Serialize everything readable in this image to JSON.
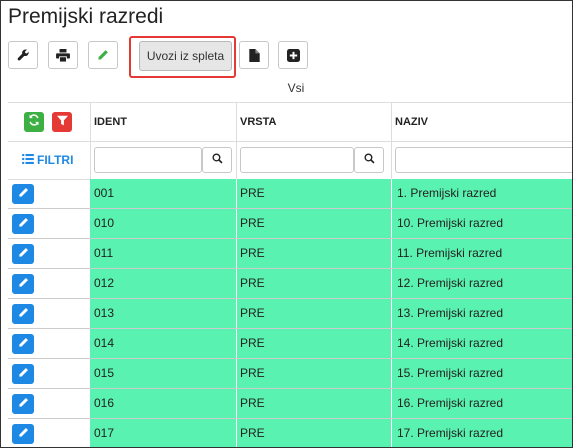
{
  "page": {
    "title": "Premijski razredi"
  },
  "toolbar": {
    "buttons": [
      {
        "name": "settings",
        "icon": "wrench-icon"
      },
      {
        "name": "print",
        "icon": "printer-icon"
      },
      {
        "name": "edit",
        "icon": "pencil-icon"
      },
      {
        "name": "new-document",
        "icon": "file-icon"
      },
      {
        "name": "add",
        "icon": "plus-square-icon"
      }
    ],
    "import_label": "Uvozi iz spleta"
  },
  "filter_label": "Vsi",
  "grid": {
    "columns": [
      "IDENT",
      "VRSTA",
      "NAZIV"
    ],
    "filtri_label": "FILTRI",
    "rows": [
      {
        "ident": "001",
        "vrsta": "PRE",
        "naziv": "1. Premijski razred"
      },
      {
        "ident": "010",
        "vrsta": "PRE",
        "naziv": "10. Premijski razred"
      },
      {
        "ident": "011",
        "vrsta": "PRE",
        "naziv": "11. Premijski razred"
      },
      {
        "ident": "012",
        "vrsta": "PRE",
        "naziv": "12. Premijski razred"
      },
      {
        "ident": "013",
        "vrsta": "PRE",
        "naziv": "13. Premijski razred"
      },
      {
        "ident": "014",
        "vrsta": "PRE",
        "naziv": "14. Premijski razred"
      },
      {
        "ident": "015",
        "vrsta": "PRE",
        "naziv": "15. Premijski razred"
      },
      {
        "ident": "016",
        "vrsta": "PRE",
        "naziv": "16. Premijski razred"
      },
      {
        "ident": "017",
        "vrsta": "PRE",
        "naziv": "17. Premijski razred"
      }
    ]
  },
  "colors": {
    "row_highlight": "#5af2b0",
    "accent_blue": "#1e88e5",
    "refresh_green": "#3cb043",
    "filter_red": "#e53935",
    "callout_red": "#e53935"
  }
}
